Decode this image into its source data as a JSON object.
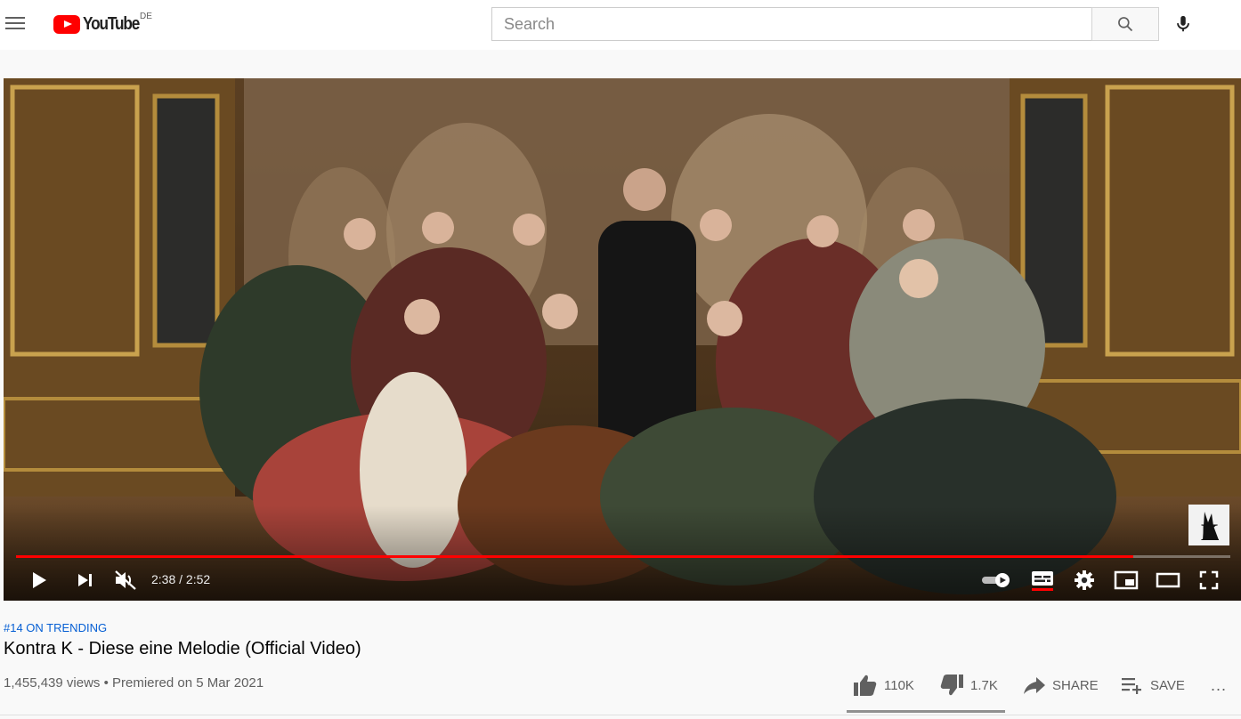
{
  "masthead": {
    "logo_text": "YouTube",
    "country_code": "DE",
    "search_placeholder": "Search"
  },
  "player": {
    "time_current": "2:38",
    "time_separator": " / ",
    "time_total": "2:52",
    "progress_fraction": 0.92,
    "muted": true,
    "watermark_text": "K"
  },
  "video": {
    "trending_label": "#14 ON TRENDING",
    "title": "Kontra K - Diese eine Melodie (Official Video)",
    "views": "1,455,439 views",
    "separator": " • ",
    "premiered": "Premiered on 5 Mar 2021"
  },
  "actions": {
    "like_count": "110K",
    "dislike_count": "1.7K",
    "share_label": "SHARE",
    "save_label": "SAVE",
    "more_label": "..."
  },
  "colors": {
    "brand_red": "#ff0000",
    "link_blue": "#065fd4",
    "secondary_text": "#606060"
  }
}
